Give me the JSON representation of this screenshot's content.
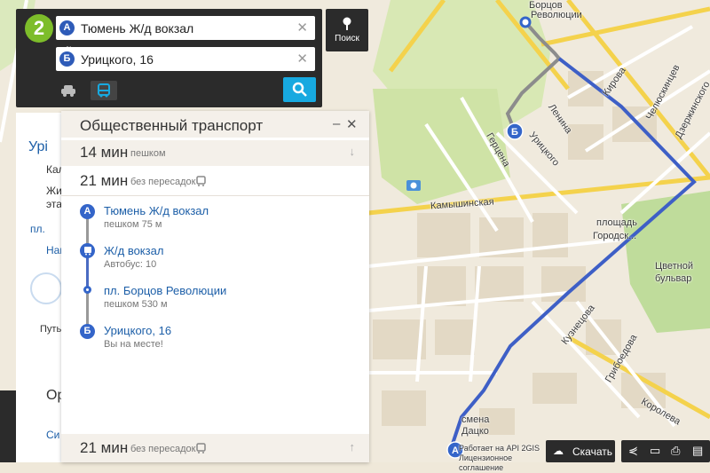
{
  "search": {
    "from_marker": "А",
    "from_value": "Тюмень Ж/д вокзал",
    "to_marker": "Б",
    "to_value": "Урицкого, 16",
    "search_button_label": "Поиск"
  },
  "left_card": {
    "title_fragment": "Урі",
    "line1": "Кал",
    "line2": "Жил",
    "line3": "эта",
    "link1": "пл.",
    "link2": "Наи",
    "route_caption": "Путь",
    "section": "Ор",
    "bottom_link": "Си"
  },
  "transport": {
    "title": "Общественный транспорт",
    "options": [
      {
        "time": "14 мин",
        "note": "пешком"
      },
      {
        "time": "21 мин",
        "note": "без пересадок"
      }
    ],
    "steps": [
      {
        "marker": "А",
        "title": "Тюмень Ж/д вокзал",
        "sub": "пешком 75 м"
      },
      {
        "title": "Ж/д вокзал",
        "sub": "Автобус: 10"
      },
      {
        "title": "пл. Борцов Революции",
        "sub": "пешком 530 м"
      },
      {
        "marker": "Б",
        "title": "Урицкого, 16",
        "sub": "Вы на месте!"
      }
    ],
    "footer": {
      "time": "21 мин",
      "note": "без пересадок"
    }
  },
  "map": {
    "labels": {
      "borcov": "Борцов",
      "revolucii": "Революции",
      "kirova": "Кирова",
      "chelyuskincev": "Челюскинцев",
      "dzerzhinskogo": "Дзержинского",
      "lenina": "Ленина",
      "gercena": "Герцена",
      "urickogo": "Урицкого",
      "kamyshinskaya": "Камышинская",
      "ploshchad": "площадь",
      "gorodskaya": "Городск...",
      "cvetnoy": "Цветной",
      "bulvar": "бульвар",
      "kuznecova": "Кузнецова",
      "griboedova": "Грибоедова",
      "koroleva": "Королева",
      "smena": "смена",
      "dacko": "Дацко"
    },
    "route_color": "#3e5fc6",
    "walk_color": "#8c8c8c",
    "start_marker": "А",
    "end_marker": "Б"
  },
  "footer": {
    "credit_line1": "Работает на API 2GIS",
    "credit_line2": "Лицензионное соглашение",
    "download_label": "Скачать"
  }
}
